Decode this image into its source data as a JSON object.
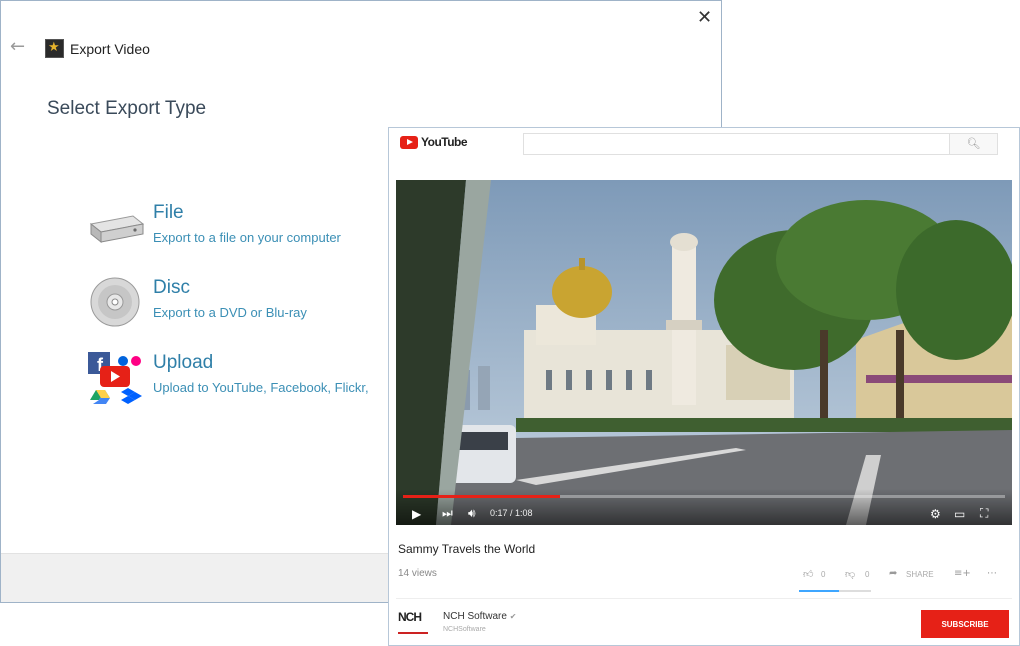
{
  "dialog": {
    "title": "Export Video",
    "heading": "Select Export Type",
    "options": [
      {
        "title": "File",
        "desc": "Export to a file on your computer",
        "icon": "hard-drive-icon"
      },
      {
        "title": "Disc",
        "desc": "Export to a DVD or Blu-ray",
        "icon": "disc-icon"
      },
      {
        "title": "Upload",
        "desc": "Upload to YouTube, Facebook, Flickr,",
        "icon": "upload-services-icon"
      }
    ]
  },
  "youtube": {
    "logo_text": "YouTube",
    "time": "0:17 / 1:08",
    "progress": 0.26,
    "video_title": "Sammy Travels the World",
    "views": "14 views",
    "likes": "0",
    "dislikes": "0",
    "share_label": "SHARE",
    "channel_name": "NCH Software",
    "channel_badge": "✔",
    "channel_sub": "NCHSoftware",
    "channel_logo": "NCH",
    "subscribe_label": "SUBSCRIBE"
  },
  "colors": {
    "link_blue": "#2f7fa8",
    "youtube_red": "#e62117"
  }
}
